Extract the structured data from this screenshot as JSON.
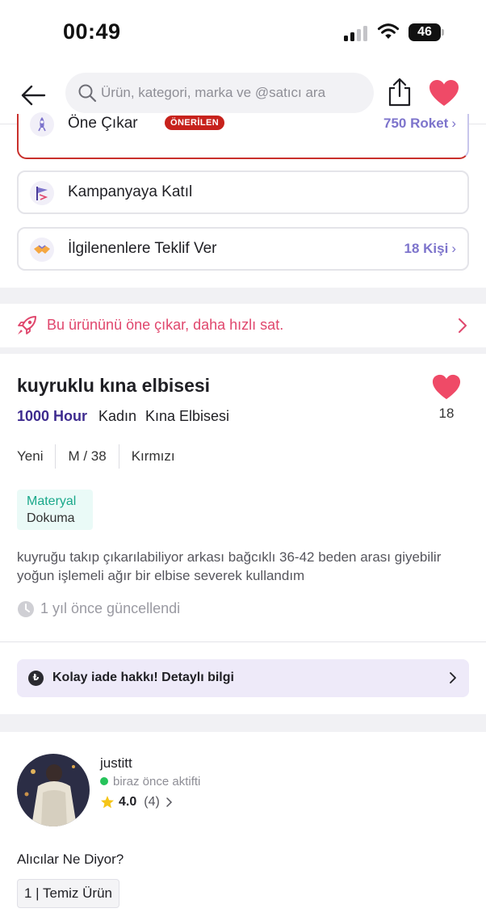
{
  "status_bar": {
    "time": "00:49",
    "battery": "46"
  },
  "header": {
    "search_placeholder": "Ürün, kategori, marka ve @satıcı ara"
  },
  "actions": {
    "promote": {
      "label": "Öne Çıkar",
      "badge": "ÖNERİLEN",
      "value": "750 Roket"
    },
    "campaign": {
      "label": "Kampanyaya Katıl"
    },
    "offer": {
      "label": "İlgilenenlere Teklif Ver",
      "value": "18 Kişi"
    }
  },
  "promo": {
    "text": "Bu ürününü öne çıkar, daha hızlı sat."
  },
  "product": {
    "title": "kuyruklu kına elbisesi",
    "likes": "18",
    "brand": "1000 Hour",
    "category": "Kadın",
    "subcategory": "Kına Elbisesi",
    "specs": [
      "Yeni",
      "M / 38",
      "Kırmızı"
    ],
    "material_label": "Materyal",
    "material_value": "Dokuma",
    "description": "kuyruğu takıp çıkarılabiliyor arkası bağcıklı 36-42 beden arası giyebilir yoğun işlemeli ağır bir elbise severek kullandım",
    "updated": "1 yıl önce güncellendi"
  },
  "return_policy": {
    "text": "Kolay iade hakkı! Detaylı bilgi",
    "icon_glyph": "₺"
  },
  "seller": {
    "name": "justitt",
    "status": "biraz önce aktifti",
    "rating": "4.0",
    "rating_count": "(4)"
  },
  "reviews": {
    "title": "Alıcılar Ne Diyor?",
    "tags": [
      "1 | Temiz Ürün"
    ]
  },
  "colors": {
    "accent": "#7d74cc",
    "heart": "#ef4a67",
    "promo": "#e0476d",
    "badge": "#c7221c",
    "brand": "#3e2b8f",
    "material": "#19a88a"
  }
}
